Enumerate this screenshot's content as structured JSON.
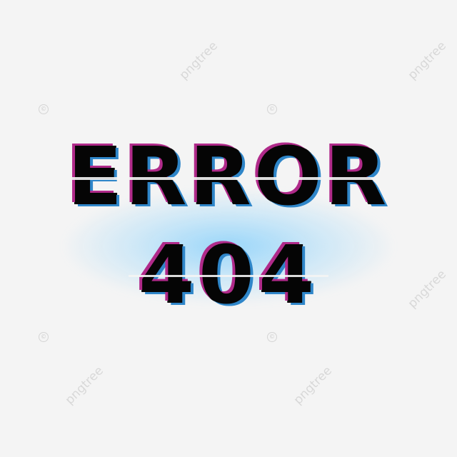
{
  "headline": {
    "line1": "ERROR",
    "line2": "404"
  },
  "watermark": {
    "text": "pngtree",
    "symbol": "©"
  },
  "colors": {
    "background": "#f4f4f4",
    "text": "#050505",
    "glitch_magenta": "#b02a8a",
    "glitch_blue": "#2f86c9",
    "glow": "#50beff"
  }
}
